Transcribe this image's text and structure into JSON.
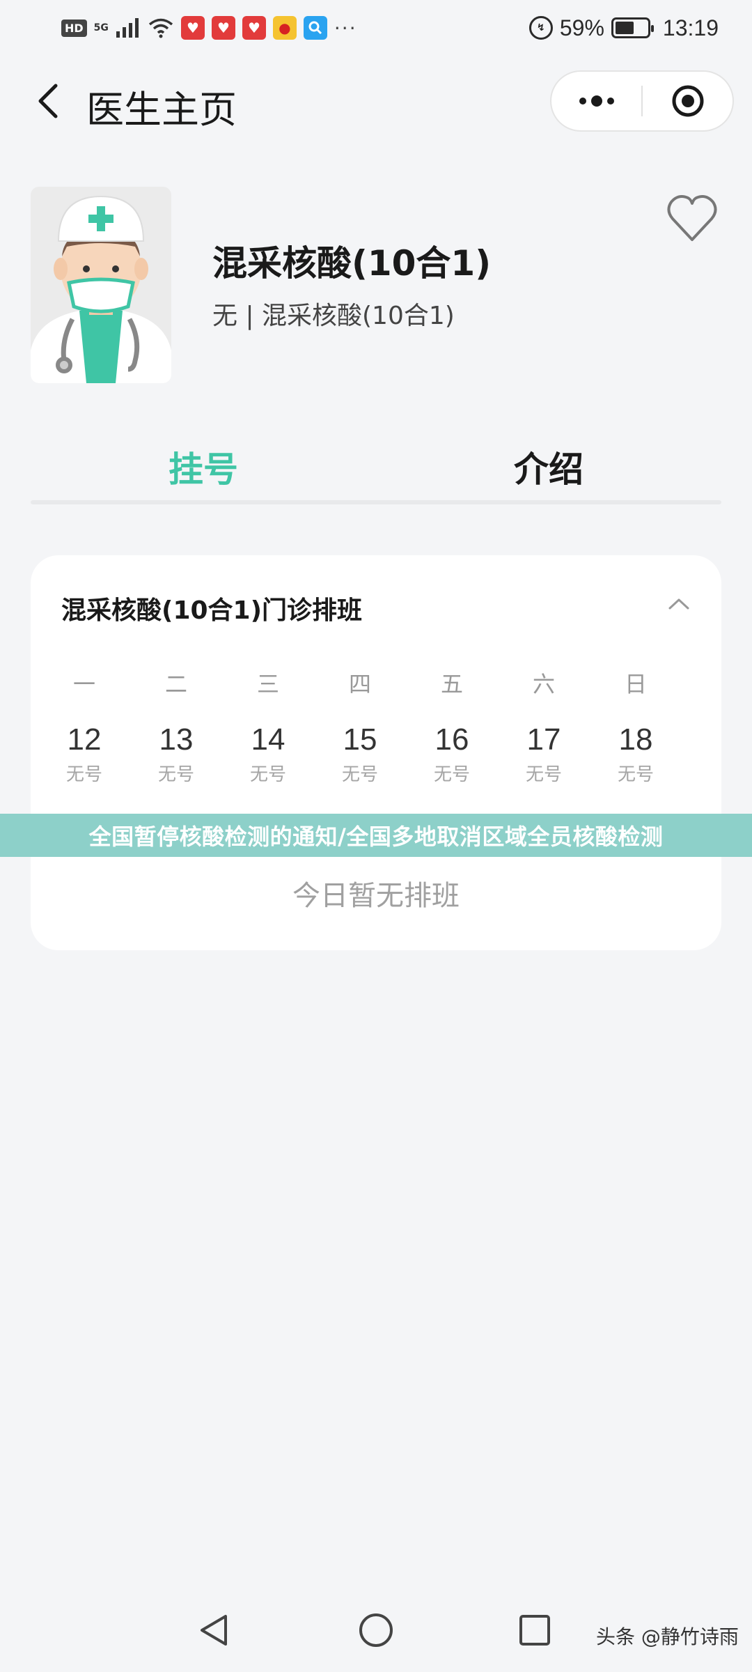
{
  "status_bar": {
    "hd": "HD",
    "network": "5G",
    "more": "···",
    "battery": "59%",
    "battery_level": 0.59,
    "time": "13:19"
  },
  "nav": {
    "title": "医生主页"
  },
  "doctor": {
    "name": "混采核酸(10合1)",
    "subtitle": "无 | 混采核酸(10合1)"
  },
  "tabs": [
    {
      "label": "挂号",
      "active": true
    },
    {
      "label": "介绍",
      "active": false
    }
  ],
  "schedule": {
    "title": "混采核酸(10合1)门诊排班",
    "days": [
      {
        "weekday": "一",
        "date": "12",
        "status": "无号"
      },
      {
        "weekday": "二",
        "date": "13",
        "status": "无号"
      },
      {
        "weekday": "三",
        "date": "14",
        "status": "无号"
      },
      {
        "weekday": "四",
        "date": "15",
        "status": "无号"
      },
      {
        "weekday": "五",
        "date": "16",
        "status": "无号"
      },
      {
        "weekday": "六",
        "date": "17",
        "status": "无号"
      },
      {
        "weekday": "日",
        "date": "18",
        "status": "无号"
      }
    ],
    "empty_text": "今日暂无排班"
  },
  "banner": {
    "text": "全国暂停核酸检测的通知/全国多地取消区域全员核酸检测"
  },
  "watermark": "头条 @静竹诗雨",
  "colors": {
    "accent": "#3fc5a5",
    "banner": "#8dd0c9",
    "background": "#f4f5f7"
  }
}
